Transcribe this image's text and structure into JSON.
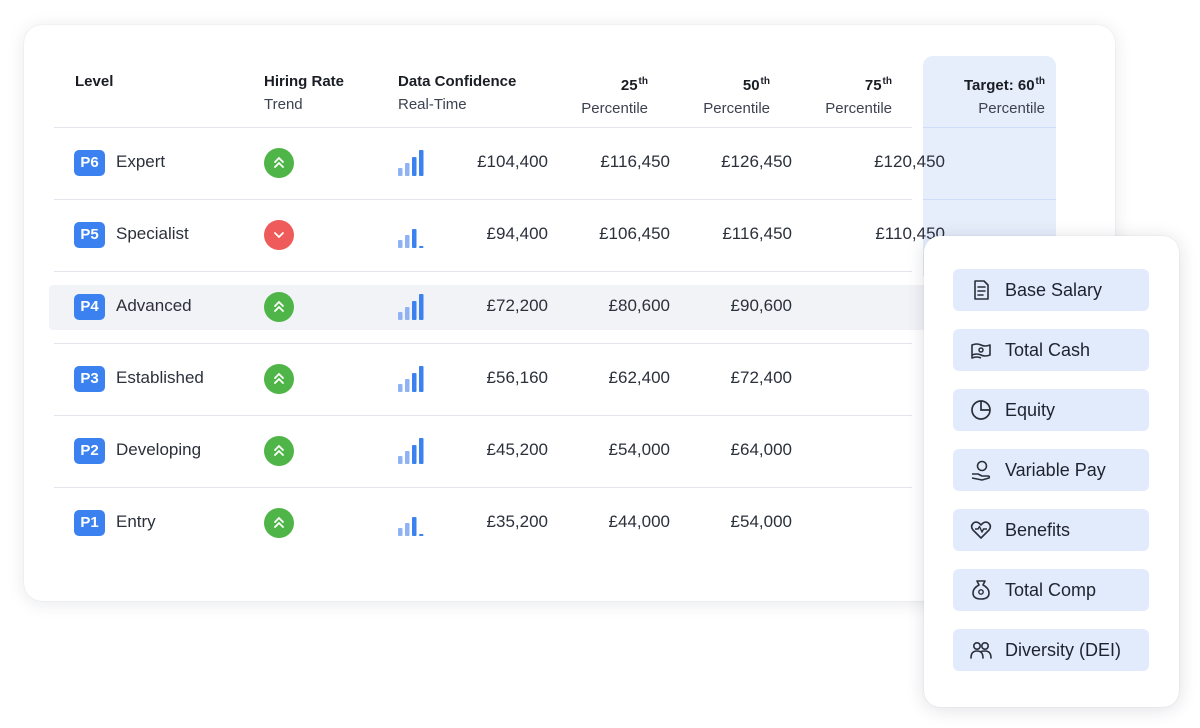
{
  "headers": {
    "level": "Level",
    "hiring_title": "Hiring Rate",
    "hiring_sub": "Trend",
    "conf_title": "Data Confidence",
    "conf_sub": "Real-Time",
    "p25_num": "25",
    "p25_sup": "th",
    "p25_sub": "Percentile",
    "p50_num": "50",
    "p50_sup": "th",
    "p50_sub": "Percentile",
    "p75_num": "75",
    "p75_sup": "th",
    "p75_sub": "Percentile",
    "target_title": "Target: 60",
    "target_sup": "th",
    "target_sub": "Percentile"
  },
  "rows": [
    {
      "code": "P6",
      "label": "Expert",
      "trend": "up",
      "confidence": 4,
      "p25": "£104,400",
      "p50": "£116,450",
      "p75": "£126,450",
      "target": "£120,450"
    },
    {
      "code": "P5",
      "label": "Specialist",
      "trend": "down",
      "confidence": 3,
      "p25": "£94,400",
      "p50": "£106,450",
      "p75": "£116,450",
      "target": "£110,450"
    },
    {
      "code": "P4",
      "label": "Advanced",
      "trend": "up",
      "confidence": 4,
      "p25": "£72,200",
      "p50": "£80,600",
      "p75": "£90,600",
      "target": ""
    },
    {
      "code": "P3",
      "label": "Established",
      "trend": "up",
      "confidence": 4,
      "p25": "£56,160",
      "p50": "£62,400",
      "p75": "£72,400",
      "target": ""
    },
    {
      "code": "P2",
      "label": "Developing",
      "trend": "up",
      "confidence": 4,
      "p25": "£45,200",
      "p50": "£54,000",
      "p75": "£64,000",
      "target": ""
    },
    {
      "code": "P1",
      "label": "Entry",
      "trend": "up",
      "confidence": 3,
      "p25": "£35,200",
      "p50": "£44,000",
      "p75": "£54,000",
      "target": ""
    }
  ],
  "menu": [
    {
      "label": "Base Salary",
      "icon": "base-salary-icon"
    },
    {
      "label": "Total Cash",
      "icon": "total-cash-icon"
    },
    {
      "label": "Equity",
      "icon": "equity-icon"
    },
    {
      "label": "Variable Pay",
      "icon": "variable-pay-icon"
    },
    {
      "label": "Benefits",
      "icon": "benefits-icon"
    },
    {
      "label": "Total Comp",
      "icon": "total-comp-icon"
    },
    {
      "label": "Diversity (DEI)",
      "icon": "diversity-icon"
    }
  ],
  "colors": {
    "badge": "#3b82f0",
    "trend_up": "#4fb548",
    "trend_down": "#ef5a5a",
    "bar_active": "#3b82f0",
    "bar_weak": "#8fb3f2",
    "target_bg": "#e6eefc",
    "pill_bg": "#e2ebfb"
  }
}
